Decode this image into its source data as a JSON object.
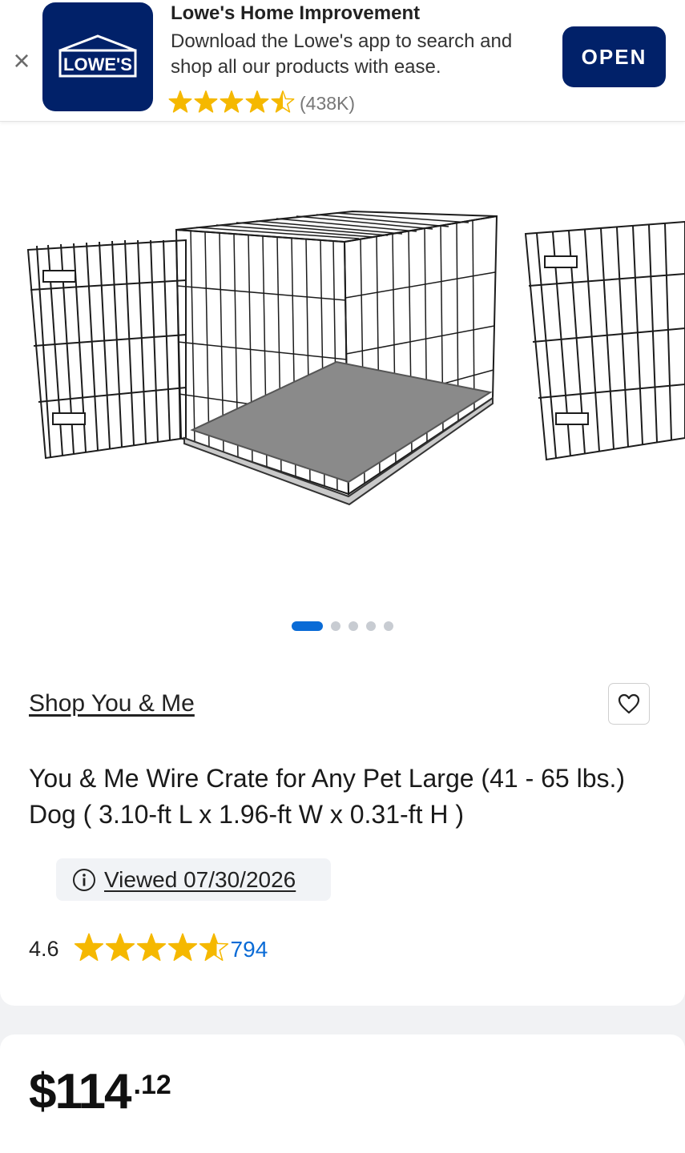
{
  "banner": {
    "close_glyph": "×",
    "app_title": "Lowe's Home Improvement",
    "description": "Download the Lowe's app to search and shop all our products with ease.",
    "logo_text": "LOWE'S",
    "rating_stars": 4.5,
    "rating_count": "(438K)",
    "open_label": "OPEN",
    "star_color": "#f5b800",
    "brand_color": "#012169"
  },
  "gallery": {
    "total_images": 5,
    "active_index": 0
  },
  "product": {
    "brand_link": "Shop You & Me",
    "title": "You & Me Wire Crate for Any Pet Large (41 - 65 lbs.) Dog ( 3.10-ft L x 1.96-ft W x 0.31-ft H )",
    "viewed_label": "Viewed 07/30/2026",
    "rating_value": "4.6",
    "rating_stars": 4.6,
    "review_count": "794",
    "link_color": "#0a6bd6"
  },
  "price": {
    "dollars": "$114",
    "cents": ".12"
  }
}
